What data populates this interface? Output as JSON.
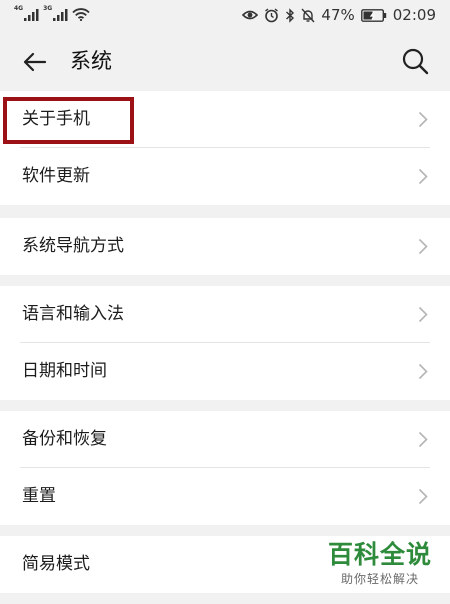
{
  "status_bar": {
    "network_1": "4G",
    "network_2": "3G",
    "battery_percent": "47%",
    "time": "02:09"
  },
  "app_bar": {
    "title": "系统"
  },
  "groups": [
    {
      "items": [
        {
          "label": "关于手机"
        },
        {
          "label": "软件更新"
        }
      ]
    },
    {
      "items": [
        {
          "label": "系统导航方式"
        }
      ]
    },
    {
      "items": [
        {
          "label": "语言和输入法"
        },
        {
          "label": "日期和时间"
        }
      ]
    },
    {
      "items": [
        {
          "label": "备份和恢复"
        },
        {
          "label": "重置"
        }
      ]
    },
    {
      "items": [
        {
          "label": "简易模式"
        }
      ]
    }
  ],
  "watermark": {
    "brand": "百科全说",
    "slogan": "助你轻松解决"
  },
  "colors": {
    "highlight_border": "#9b1115",
    "watermark_green": "#2e8b3c",
    "background": "#f1f1f1"
  }
}
